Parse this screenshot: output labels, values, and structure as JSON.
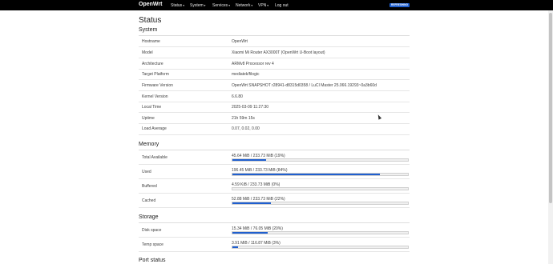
{
  "header": {
    "brand": "OpenWrt",
    "menu": [
      {
        "label": "Status",
        "caret": "▾"
      },
      {
        "label": "System",
        "caret": "▾"
      },
      {
        "label": "Services",
        "caret": "▾"
      },
      {
        "label": "Network",
        "caret": "▾"
      },
      {
        "label": "VPN",
        "caret": "▾"
      },
      {
        "label": "Log out",
        "caret": ""
      }
    ],
    "refresh_label": "REFRESHING"
  },
  "page_title": "Status",
  "system": {
    "title": "System",
    "rows": [
      {
        "label": "Hostname",
        "value": "OpenWrt"
      },
      {
        "label": "Model",
        "value": "Xiaomi Mi Router AX3000T (OpenWrt U-Boot layout)"
      },
      {
        "label": "Architecture",
        "value": "ARMv8 Processor rev 4"
      },
      {
        "label": "Target Platform",
        "value": "mediatek/filogic"
      },
      {
        "label": "Firmware Version",
        "value": "OpenWrt SNAPSHOT r28941-d8315d0358 / LuCI Master 25.066.19293~0a3b60d"
      },
      {
        "label": "Kernel Version",
        "value": "6.6.80"
      },
      {
        "label": "Local Time",
        "value": "2025-03-09 11:27:30"
      },
      {
        "label": "Uptime",
        "value": "21h 59m 15s"
      },
      {
        "label": "Load Average",
        "value": "0.07, 0.02, 0.00"
      }
    ]
  },
  "memory": {
    "title": "Memory",
    "rows": [
      {
        "label": "Total Available",
        "value": "45.64 MiB / 233.73 MiB (19%)",
        "fraction": 0.19
      },
      {
        "label": "Used",
        "value": "196.45 MiB / 233.73 MiB (84%)",
        "fraction": 0.84
      },
      {
        "label": "Buffered",
        "value": "4.59 KiB / 233.73 MiB (0%)",
        "fraction": 0.0
      },
      {
        "label": "Cached",
        "value": "52.88 MiB / 233.73 MiB (22%)",
        "fraction": 0.22
      }
    ]
  },
  "storage": {
    "title": "Storage",
    "rows": [
      {
        "label": "Disk space",
        "value": "15.34 MiB / 76.05 MiB (20%)",
        "fraction": 0.2
      },
      {
        "label": "Temp space",
        "value": "3.91 MiB / 116.87 MiB (3%)",
        "fraction": 0.03
      }
    ]
  },
  "port_status": {
    "title": "Port status"
  },
  "colors": {
    "accent": "#1f5fcf",
    "topbar": "#000000"
  }
}
